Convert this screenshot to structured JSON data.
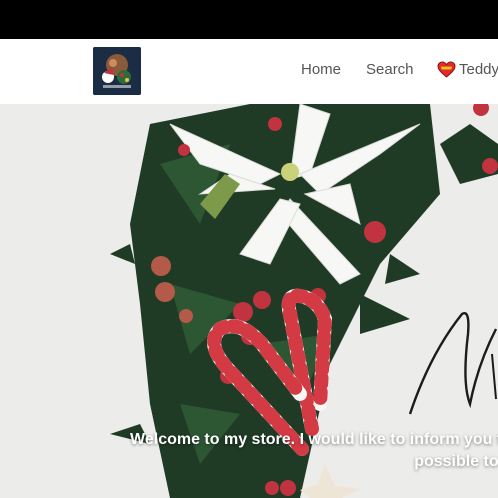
{
  "nav": {
    "home": "Home",
    "search": "Search",
    "teddy": "Teddy",
    "teddy_icon": "heart-icon"
  },
  "logo": {
    "icon": "christmas-store-logo"
  },
  "hero": {
    "line1": "Welcome to my store. I would like to inform you th",
    "line2": "possible to e"
  },
  "colors": {
    "topbar": "#000000",
    "header_bg": "#ffffff",
    "nav_text": "#555555",
    "hero_bg": "#ececeb",
    "berry": "#c0333f",
    "candy_cane": "#d43a44"
  }
}
